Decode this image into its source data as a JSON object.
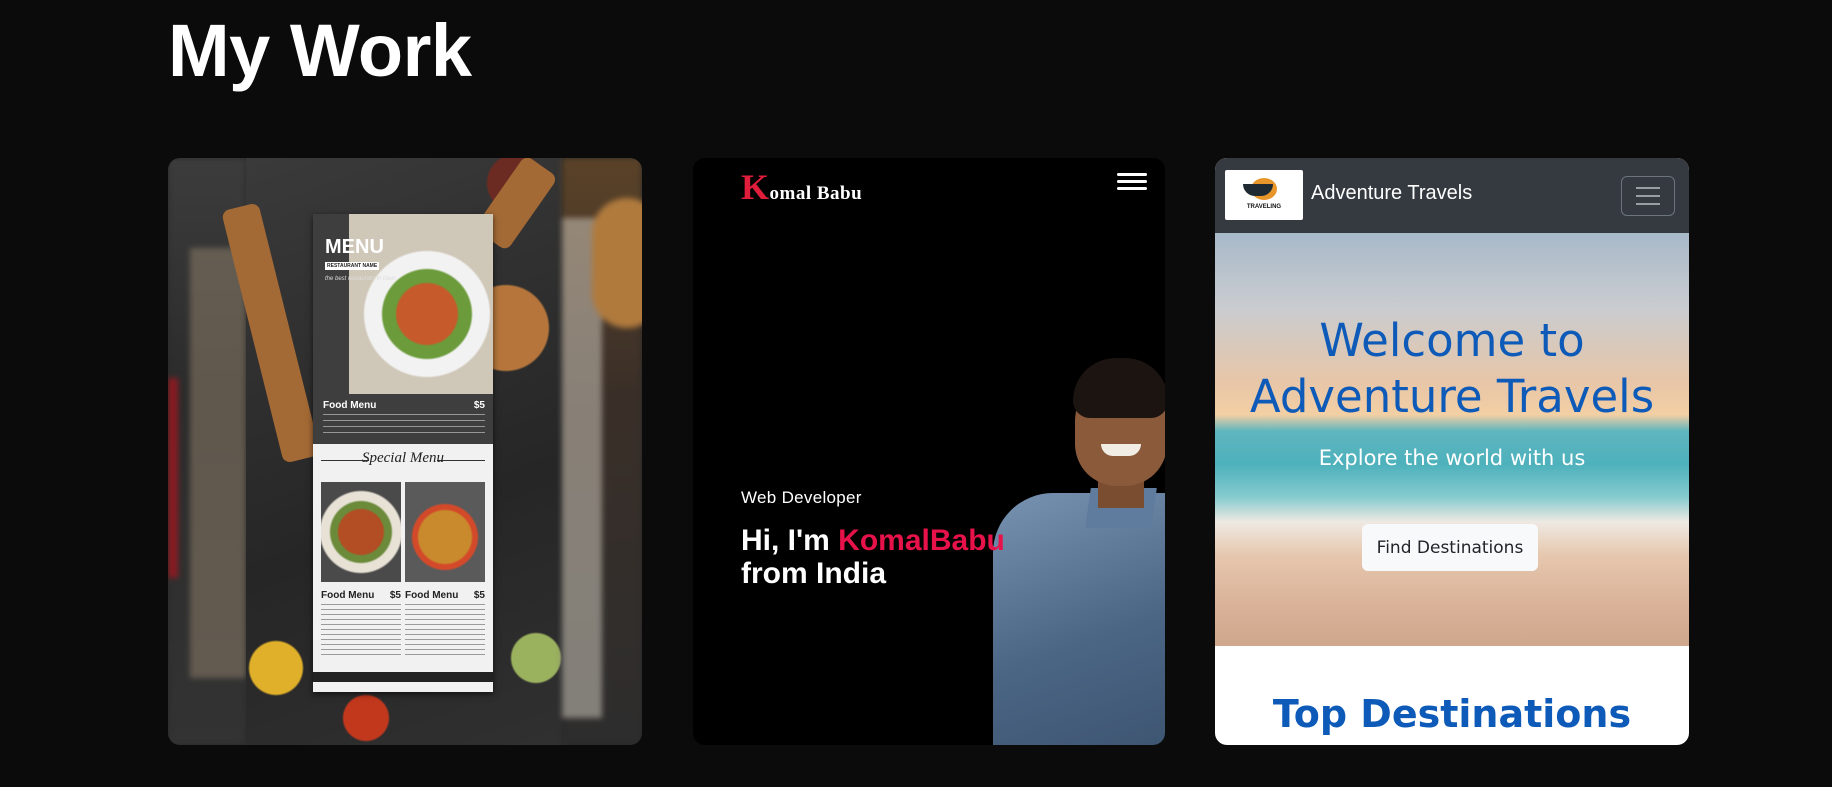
{
  "section": {
    "title": "My Work"
  },
  "projects": [
    {
      "menu": {
        "heading": "MENU",
        "restaurant": "RESTAURANT NAME",
        "tagline": "the best restaurant in town",
        "item_label": "Food Menu",
        "item_price": "$5",
        "special_heading": "Special Menu"
      }
    },
    {
      "logo_initial": "K",
      "logo_rest": "omal Babu",
      "role": "Web Developer",
      "greeting": "Hi, I'm ",
      "name": "KomalBabu",
      "location": "from India",
      "accent_color": "#e8124a"
    },
    {
      "logo_text": "TRAVELING",
      "brand": "Adventure Travels",
      "hero_title_line1": "Welcome to",
      "hero_title_line2": "Adventure Travels",
      "hero_subtitle": "Explore the world with us",
      "cta": "Find Destinations",
      "section_heading": "Top Destinations",
      "accent_color": "#0d5ab8"
    }
  ]
}
